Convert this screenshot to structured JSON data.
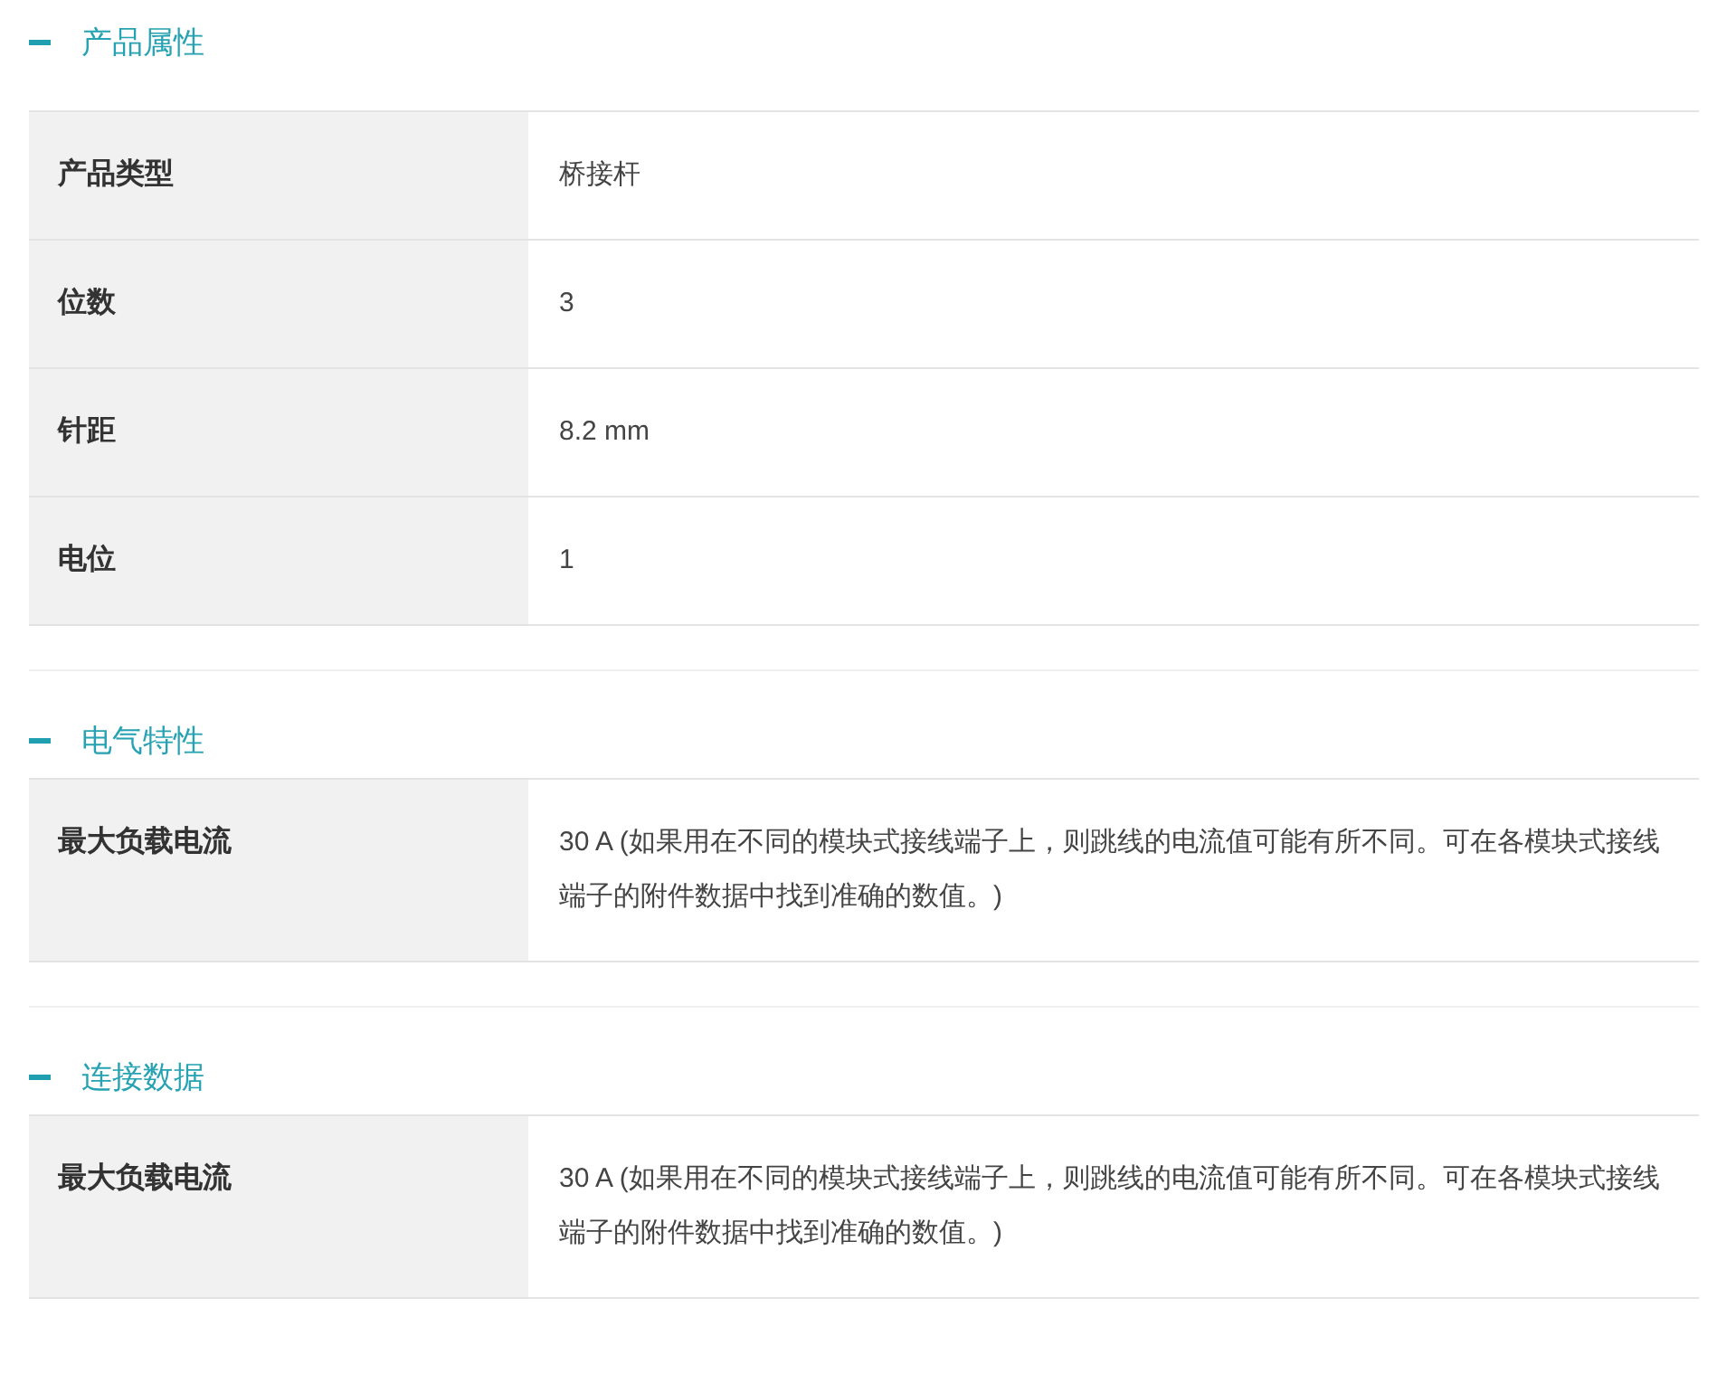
{
  "sections": [
    {
      "title": "产品属性",
      "expanded": true,
      "rows": [
        {
          "label": "产品类型",
          "value": "桥接杆"
        },
        {
          "label": "位数",
          "value": "3"
        },
        {
          "label": "针距",
          "value": "8.2 mm"
        },
        {
          "label": "电位",
          "value": "1"
        }
      ]
    },
    {
      "title": "电气特性",
      "expanded": true,
      "rows": [
        {
          "label": "最大负载电流",
          "value": "30 A (如果用在不同的模块式接线端子上，则跳线的电流值可能有所不同。可在各模块式接线端子的附件数据中找到准确的数值。)"
        }
      ]
    },
    {
      "title": "连接数据",
      "expanded": true,
      "rows": [
        {
          "label": "最大负载电流",
          "value": "30 A (如果用在不同的模块式接线端子上，则跳线的电流值可能有所不同。可在各模块式接线端子的附件数据中找到准确的数值。)"
        }
      ]
    }
  ]
}
